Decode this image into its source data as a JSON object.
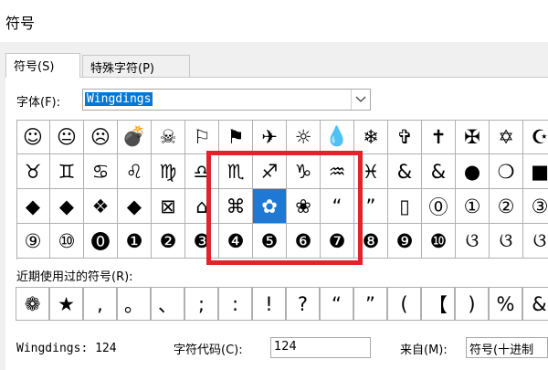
{
  "window": {
    "title": "符号"
  },
  "tabs": [
    {
      "label": "符号(S)"
    },
    {
      "label": "特殊字符(P)"
    }
  ],
  "font": {
    "label": "字体(F):",
    "value": "Wingdings"
  },
  "symbol_grid": {
    "rows": [
      [
        "☺",
        "😐",
        "☹",
        "💣",
        "☠",
        "⚐",
        "⚑",
        "✈",
        "☼",
        "💧",
        "❄",
        "✞",
        "✝",
        "✠",
        "✡",
        "☪",
        "☯"
      ],
      [
        "♉",
        "♊",
        "♋",
        "♌",
        "♍",
        "♎",
        "♏",
        "♐",
        "♑",
        "♒",
        "♓",
        "&",
        "&",
        "●",
        "❍",
        "■",
        "□",
        "◻"
      ],
      [
        "◆",
        "◆",
        "❖",
        "◆",
        "⊠",
        "⌂",
        "⌘",
        "✿",
        "❀",
        "“",
        "”",
        "▯",
        "⓪",
        "①",
        "②",
        "③",
        "④"
      ],
      [
        "⑨",
        "⑩",
        "⓿",
        "❶",
        "❷",
        "❸",
        "❹",
        "❺",
        "❻",
        "❼",
        "❽",
        "❾",
        "❿",
        "ଓ",
        "ଓ",
        "ଓ",
        "ଓ"
      ]
    ],
    "selected": {
      "row": 2,
      "col": 7
    }
  },
  "recent": {
    "label": "近期使用过的符号(R):",
    "symbols": [
      "❁",
      "★",
      ",",
      "。",
      "、",
      ";",
      ":",
      "!",
      "?",
      "“",
      "”",
      "(",
      "【",
      ")",
      "%",
      "&",
      "】",
      "※"
    ]
  },
  "status": {
    "font_code": "Wingdings: 124",
    "char_code_label": "字符代码(C):",
    "char_code_value": "124",
    "from_label": "来自(M):",
    "from_value": "符号(十进制"
  }
}
